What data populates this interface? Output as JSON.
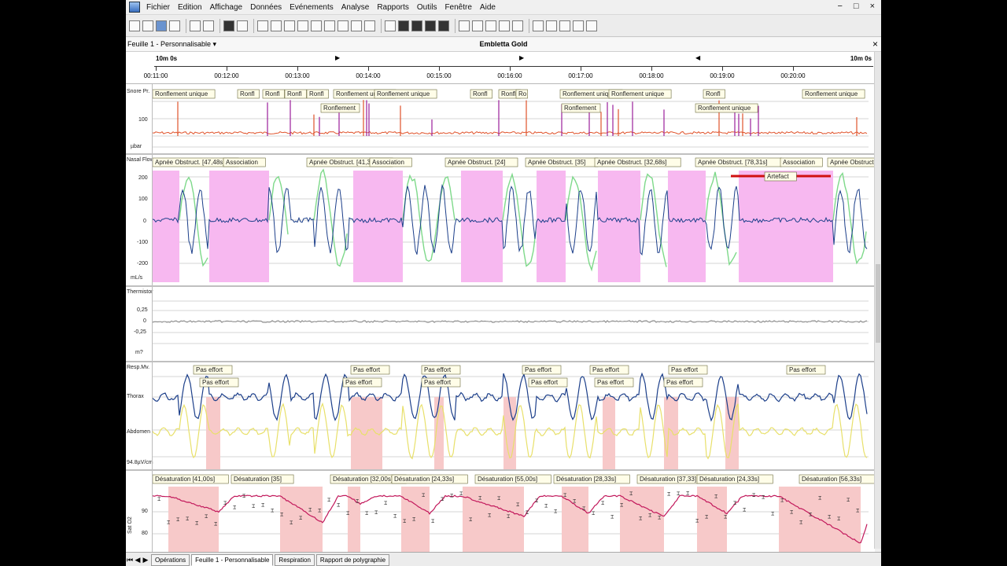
{
  "menu": [
    "Fichier",
    "Edition",
    "Affichage",
    "Données",
    "Evénements",
    "Analyse",
    "Rapports",
    "Outils",
    "Fenêtre",
    "Aide"
  ],
  "window_controls": [
    "−",
    "□",
    "×"
  ],
  "sheet": {
    "name": "Feuille 1 - Personnalisable ▾",
    "title": "Embletta Gold",
    "close": "×"
  },
  "time": {
    "scale_left": "10m 0s",
    "scale_right": "10m 0s",
    "ticks": [
      "00:11:00",
      "00:12:00",
      "00:13:00",
      "00:14:00",
      "00:15:00",
      "00:16:00",
      "00:17:00",
      "00:18:00",
      "00:19:00",
      "00:20:00"
    ]
  },
  "channels": {
    "snore": {
      "name": "Snore Pr.",
      "unit": "µbar",
      "tick": "100",
      "events_top": [
        "Ronflement unique",
        "Ronfl",
        "Ronfl",
        "Ronfl",
        "Ronfl",
        "Ronflement unique",
        "Ronflement unique",
        "Ronfl",
        "Ronfl",
        "Ro",
        "Ronflement unique",
        "Ronflement unique",
        "Ronfl",
        "Ronflement unique"
      ],
      "events_bottom": [
        "Ronflement",
        "Ronflement",
        "Ronflement unique"
      ]
    },
    "nasal": {
      "name": "Nasal Flow",
      "unit": "mL/s",
      "ticks": [
        "200",
        "100",
        "0",
        "-100",
        "-200"
      ],
      "events": [
        "Apnée Obstruct. [47,48s]",
        "Association",
        "Apnée Obstruct. [41,33s]",
        "Association",
        "Apnée Obstruct. [24]",
        "Apnée Obstruct. [35]",
        "Apnée Obstruct. [32,68s]",
        "Apnée Obstruct. [78,31s]",
        "Association",
        "Apnée Obstruct."
      ],
      "artefact": "Artefact"
    },
    "thermistor": {
      "name": "Thermistor",
      "unit": "m?",
      "ticks": [
        "0,25",
        "0",
        "-0,25"
      ]
    },
    "resp": {
      "name": "Resp.Mv.",
      "thorax": "Thorax",
      "abdomen": "Abdomen",
      "unit": "94.8µV/cm",
      "events": [
        "Pas effort",
        "Pas effort",
        "Pas effort",
        "Pas effort",
        "Pas effort",
        "Pas effort",
        "Pas effort",
        "Pas effort",
        "Pas effort",
        "Pas effort",
        "Pas effort",
        "Pas effort",
        "Pas effort"
      ]
    },
    "spo2": {
      "name": "Sat O2",
      "ticks": [
        "90",
        "80"
      ],
      "events": [
        "Désaturation [41,00s]",
        "Désaturation [35]",
        "Désaturation [32,00s]",
        "Désaturation [24,33s]",
        "Désaturation [55,00s]",
        "Désaturation [28,33s]",
        "Désaturation [37,33]",
        "Désaturation [24,33s]",
        "Désaturation [56,33s]"
      ]
    }
  },
  "tabs": [
    "Opérations",
    "Feuille 1 - Personnalisable",
    "Respiration",
    "Rapport de polygraphie"
  ],
  "tab_nav": [
    "⏮",
    "◀",
    "▶"
  ],
  "colors": {
    "apnea_band": "#f7b8f0",
    "desat_band": "#f7c9c9",
    "nasal_trace": "#1c3f8a",
    "breath_trace": "#7ed98a",
    "snore_trace": "#e0522a",
    "snore_marker": "#9b1f9b",
    "thorax_trace": "#1c3f8a",
    "abdomen_trace": "#e8e06a",
    "spo2_trace": "#c2185b"
  }
}
